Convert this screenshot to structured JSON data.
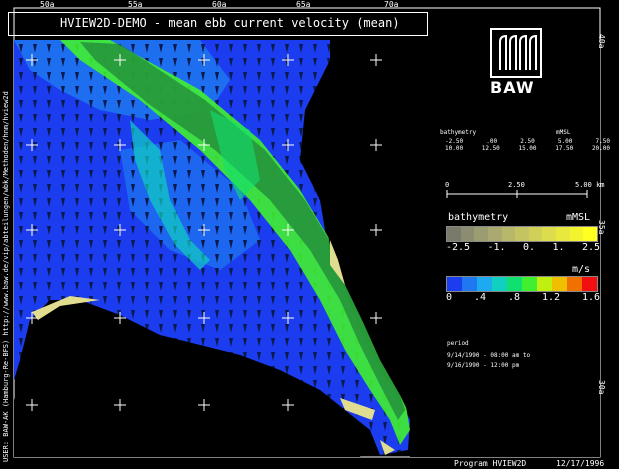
{
  "title": "HVIEW2D-DEMO - mean ebb current velocity (mean)",
  "top_ticks": [
    "50a",
    "55a",
    "60a",
    "65a",
    "70a"
  ],
  "right_ticks": [
    "40a",
    "35a",
    "30a"
  ],
  "left_vertical_text": "USER: BAW-AK (Hamburg-Re-BFS)  http://www.baw.de/vip/abteilungen/wbk/Methoden/hnm/hview2d",
  "logo": {
    "text": "BAW"
  },
  "bathymetry_table": {
    "heading_left": "bathymetry",
    "heading_right": "mMSL",
    "row1": [
      "-2.50",
      ".00",
      "2.50",
      "5.00",
      "7.50"
    ],
    "row2": [
      "10.00",
      "12.50",
      "15.00",
      "17.50",
      "20.00"
    ]
  },
  "scale_bar": {
    "labels": [
      "0",
      "2.50",
      "5.00 km"
    ]
  },
  "bathymetry_legend": {
    "title": "bathymetry",
    "unit": "mMSL",
    "ticks": [
      "-2.5",
      "-1.",
      "0.",
      "1.",
      "2.5"
    ],
    "colors": [
      "#7a7a6a",
      "#8c8c70",
      "#9c9c72",
      "#aaaa70",
      "#b8b86a",
      "#c4c462",
      "#d0d058",
      "#dcdc4c",
      "#e8e83e",
      "#f4f42e",
      "#ffff20"
    ]
  },
  "velocity_legend": {
    "unit": "m/s",
    "ticks": [
      "0",
      ".4",
      ".8",
      "1.2",
      "1.6"
    ],
    "colors": [
      "#1c3cf0",
      "#1e78f0",
      "#1eaaf0",
      "#10d0c0",
      "#10e070",
      "#40f030",
      "#c0f010",
      "#f0c000",
      "#f07000",
      "#f01010"
    ]
  },
  "period": {
    "label": "period",
    "start": "9/14/1990 - 08:00 am to",
    "end": "9/16/1990 - 12:00 pm"
  },
  "footer": {
    "program": "Program  HVIEW2D",
    "date": "12/17/1996"
  },
  "colors": {
    "background": "#000000",
    "deep": "#1c3cf0",
    "mid": "#1e78f0",
    "fast": "#40f030",
    "land": "#000000",
    "shoal": "#e0dc90"
  }
}
